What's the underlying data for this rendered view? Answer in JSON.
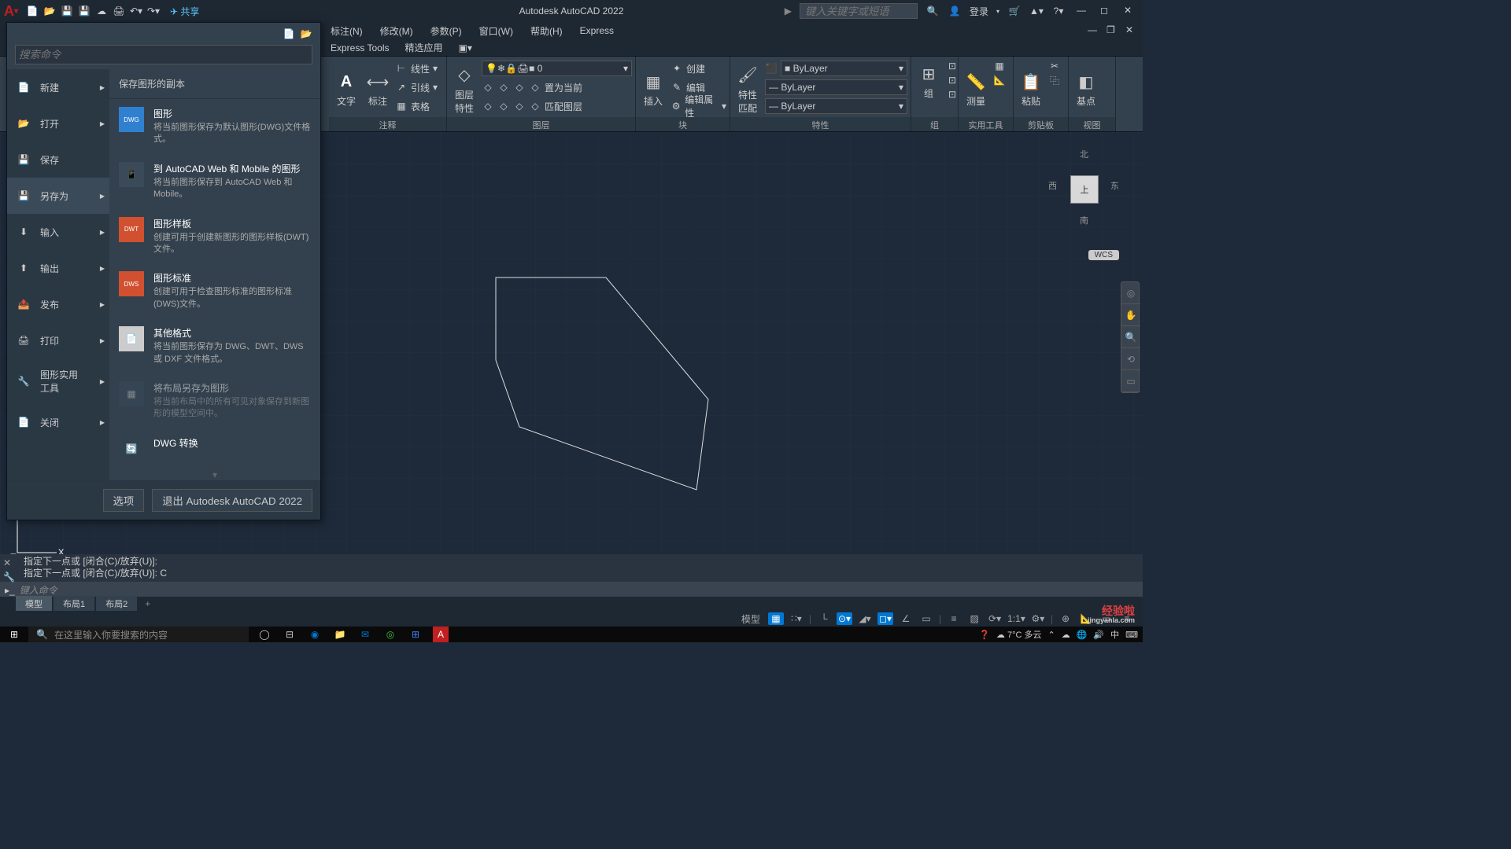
{
  "title_bar": {
    "app_title": "Autodesk AutoCAD 2022",
    "share": "共享",
    "search_placeholder": "键入关键字或短语",
    "login": "登录"
  },
  "menu": {
    "items": [
      "标注(N)",
      "修改(M)",
      "参数(P)",
      "窗口(W)",
      "帮助(H)",
      "Express"
    ]
  },
  "tabs": {
    "items": [
      "Express Tools",
      "精选应用"
    ]
  },
  "ribbon": {
    "annot": {
      "text": "文字",
      "dim": "标注",
      "linear": "线性",
      "leader": "引线",
      "table": "表格",
      "panel": "注释"
    },
    "layer": {
      "props": "图层\n特性",
      "current": "0",
      "set_current": "置为当前",
      "match": "匹配图层",
      "panel": "图层"
    },
    "insert": {
      "label": "插入",
      "panel": "块"
    },
    "block": {
      "create": "创建",
      "edit": "编辑",
      "edit_attr": "编辑属性"
    },
    "props": {
      "match": "特性\n匹配",
      "bylayer": "ByLayer",
      "panel": "特性"
    },
    "group": {
      "label": "组",
      "panel": "组"
    },
    "util": {
      "measure": "测量",
      "panel": "实用工具"
    },
    "clip": {
      "paste": "粘贴",
      "panel": "剪贴板"
    },
    "view": {
      "base": "基点",
      "panel": "视图"
    }
  },
  "app_menu": {
    "search_placeholder": "搜索命令",
    "left_items": [
      {
        "label": "新建"
      },
      {
        "label": "打开"
      },
      {
        "label": "保存"
      },
      {
        "label": "另存为"
      },
      {
        "label": "输入"
      },
      {
        "label": "输出"
      },
      {
        "label": "发布"
      },
      {
        "label": "打印"
      },
      {
        "label": "图形实用\n工具"
      },
      {
        "label": "关闭"
      }
    ],
    "submenu_header": "保存图形的副本",
    "submenu": [
      {
        "title": "图形",
        "desc": "将当前图形保存为默认图形(DWG)文件格式。",
        "badge": "DWG"
      },
      {
        "title": "到 AutoCAD Web 和 Mobile 的图形",
        "desc": "将当前图形保存到 AutoCAD Web 和 Mobile。",
        "badge": ""
      },
      {
        "title": "图形样板",
        "desc": "创建可用于创建新图形的图形样板(DWT)文件。",
        "badge": "DWT"
      },
      {
        "title": "图形标准",
        "desc": "创建可用于检查图形标准的图形标准(DWS)文件。",
        "badge": "DWS"
      },
      {
        "title": "其他格式",
        "desc": "将当前图形保存为 DWG、DWT、DWS 或 DXF 文件格式。",
        "badge": ""
      },
      {
        "title": "将布局另存为图形",
        "desc": "将当前布局中的所有可见对象保存到新图形的模型空间中。",
        "badge": "",
        "disabled": true
      },
      {
        "title": "DWG 转换",
        "desc": "",
        "badge": ""
      }
    ],
    "footer": {
      "options": "选项",
      "exit": "退出 Autodesk AutoCAD 2022"
    }
  },
  "viewcube": {
    "north": "北",
    "south": "南",
    "east": "东",
    "west": "西",
    "top": "上",
    "wcs": "WCS"
  },
  "cmd": {
    "history1": "指定下一点或 [闭合(C)/放弃(U)]:",
    "history2": "指定下一点或 [闭合(C)/放弃(U)]: C",
    "placeholder": "键入命令"
  },
  "doc_tabs": {
    "model": "模型",
    "layout1": "布局1",
    "layout2": "布局2"
  },
  "status": {
    "model": "模型",
    "scale": "1:1"
  },
  "taskbar": {
    "search_placeholder": "在这里输入你要搜索的内容",
    "weather": "7°C 多云",
    "ime": "中"
  },
  "watermark": {
    "main": "经验啦",
    "sub": "jingyanla.com"
  }
}
